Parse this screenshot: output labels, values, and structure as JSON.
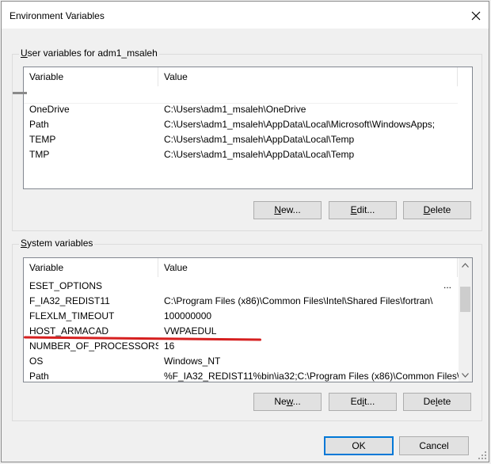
{
  "window": {
    "title": "Environment Variables"
  },
  "user_section": {
    "label_prefix": "U",
    "label_rest": "ser variables for adm1_msaleh",
    "columns": [
      "Variable",
      "Value"
    ],
    "rows": [
      {
        "variable": "OneDrive",
        "value": "C:\\Users\\adm1_msaleh\\OneDrive"
      },
      {
        "variable": "Path",
        "value": "C:\\Users\\adm1_msaleh\\AppData\\Local\\Microsoft\\WindowsApps;"
      },
      {
        "variable": "TEMP",
        "value": "C:\\Users\\adm1_msaleh\\AppData\\Local\\Temp"
      },
      {
        "variable": "TMP",
        "value": "C:\\Users\\adm1_msaleh\\AppData\\Local\\Temp"
      }
    ],
    "buttons": {
      "new_u": "N",
      "new_rest": "ew...",
      "edit_u": "E",
      "edit_rest": "dit...",
      "delete_u": "D",
      "delete_rest": "elete"
    }
  },
  "system_section": {
    "label_prefix": "S",
    "label_rest": "ystem variables",
    "columns": [
      "Variable",
      "Value"
    ],
    "rows": [
      {
        "variable": "ESET_OPTIONS",
        "value": ""
      },
      {
        "variable": "F_IA32_REDIST11",
        "value": "C:\\Program Files (x86)\\Common Files\\Intel\\Shared Files\\fortran\\"
      },
      {
        "variable": "FLEXLM_TIMEOUT",
        "value": "100000000"
      },
      {
        "variable": "HOST_ARMACAD",
        "value": "VWPAEDUL"
      },
      {
        "variable": "NUMBER_OF_PROCESSORS",
        "value": "16"
      },
      {
        "variable": "OS",
        "value": "Windows_NT"
      },
      {
        "variable": "Path",
        "value": "%F_IA32_REDIST11%bin\\ia32;C:\\Program Files (x86)\\Common Files\\..."
      }
    ],
    "overflow_marker": "...",
    "buttons": {
      "new_pre": "Ne",
      "new_u": "w",
      "new_rest": "...",
      "edit_pre": "Ed",
      "edit_u": "i",
      "edit_rest": "t...",
      "delete_pre": "De",
      "delete_u": "l",
      "delete_rest": "ete"
    }
  },
  "footer": {
    "ok": "OK",
    "cancel": "Cancel"
  },
  "colors": {
    "accent": "#0078d7",
    "annotation": "#d62020"
  }
}
